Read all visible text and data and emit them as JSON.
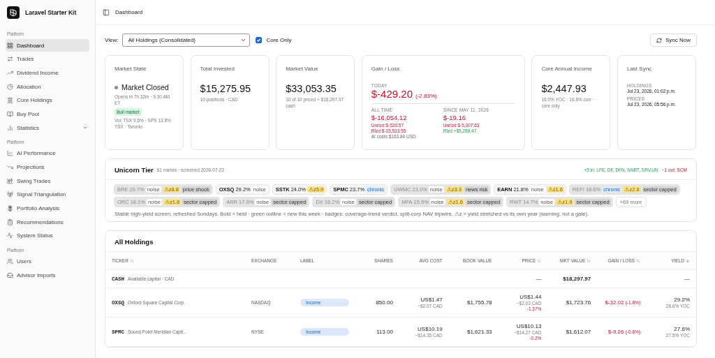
{
  "app": {
    "name": "Laravel Starter Kit"
  },
  "sidebar": {
    "sections": [
      {
        "label": "Platform",
        "items": [
          {
            "label": "Dashboard",
            "kind": "link",
            "selected": true
          },
          {
            "label": "Trades",
            "kind": "link",
            "selected": false
          },
          {
            "label": "Dividend Income",
            "kind": "link",
            "selected": false
          },
          {
            "label": "Allocation",
            "kind": "link",
            "selected": false
          },
          {
            "label": "Core Holdings",
            "kind": "link",
            "selected": false
          },
          {
            "label": "Buy Pool",
            "kind": "link",
            "selected": false
          },
          {
            "label": "Statistics",
            "kind": "group",
            "selected": false,
            "expanded": false
          }
        ]
      },
      {
        "label": "Platform",
        "items": [
          {
            "label": "AI Performance",
            "kind": "link",
            "selected": false
          },
          {
            "label": "Projections",
            "kind": "link",
            "selected": false
          },
          {
            "label": "Swing Trades",
            "kind": "link",
            "selected": false
          },
          {
            "label": "Signal Triangulation",
            "kind": "link",
            "selected": false
          },
          {
            "label": "Portfolio Analysis",
            "kind": "link",
            "selected": false
          },
          {
            "label": "Recommendations",
            "kind": "link",
            "selected": false
          },
          {
            "label": "System Status",
            "kind": "link",
            "selected": false
          }
        ]
      },
      {
        "label": "Platform",
        "items": [
          {
            "label": "Users",
            "kind": "link",
            "selected": false
          },
          {
            "label": "Advisor Imports",
            "kind": "link",
            "selected": false
          }
        ]
      }
    ]
  },
  "header": {
    "title": "Dashboard"
  },
  "controls": {
    "view_label": "View:",
    "view_value": "All Holdings (Consolidated)",
    "core_only": {
      "label": "Core Only",
      "checked": true
    },
    "sync_button": "Sync Now"
  },
  "market_state": {
    "title": "Market State",
    "status": "Market Closed",
    "opens": "Opens in 7h 32m · 9:30 AM ET",
    "regime": "Bull market",
    "vol": "Vol: TSX 9.6% · SPX 13.8%",
    "exchange": "TSX · Toronto"
  },
  "total_invested": {
    "title": "Total Invested",
    "value": "$15,275.95",
    "note": "10 positions · CAD"
  },
  "market_value": {
    "title": "Market Value",
    "value": "$33,053.35",
    "note": "10 of 10 priced + $18,297.97 cash"
  },
  "gain_loss": {
    "title": "Gain / Loss",
    "today_label": "TODAY",
    "today_value": "$-429.20",
    "today_pct": "(-2.83%)",
    "all_time": {
      "label": "ALL TIME",
      "value": "$-16,054.12",
      "lines": [
        {
          "text": "Unrlzd $-520.57",
          "kind": "loss"
        },
        {
          "text": "Rlzd $-15,533.55",
          "kind": "loss"
        },
        {
          "text": "AI costs $163.84 USD",
          "kind": "muted"
        }
      ]
    },
    "since": {
      "label": "SINCE MAY 11, 2026",
      "value": "$-19.16",
      "lines": [
        {
          "text": "Unrlzd $-5,307.63",
          "kind": "loss"
        },
        {
          "text": "Rlzd +$5,288.47",
          "kind": "gain"
        }
      ]
    }
  },
  "core_income": {
    "title": "Core Annual Income",
    "value": "$2,447.93",
    "note": "16.0% YOC · 16.6% curr · core only"
  },
  "last_sync": {
    "title": "Last Sync",
    "entries": [
      {
        "label": "HOLDINGS",
        "value": "Jul 23, 2026, 01:02 p.m."
      },
      {
        "label": "PRICES",
        "value": "Jul 23, 2026, 05:56 p.m."
      }
    ]
  },
  "unicorn": {
    "title": "Unicorn Tier",
    "meta": "81 names · screened 2026-07-23",
    "added": "+5 in: LFE, DF, DFN, NXRT, SRV.UN",
    "removed": "−1 out: SCM",
    "chips": [
      {
        "ticker": "BRE",
        "yield": "29.7%",
        "held": false,
        "badges": [
          {
            "text": "noise",
            "kind": "noise"
          },
          {
            "text": "⚠z8.8",
            "kind": "z"
          },
          {
            "text": "price shock",
            "kind": "tag"
          }
        ]
      },
      {
        "ticker": "OXSQ",
        "yield": "29.2%",
        "held": true,
        "badges": [
          {
            "text": "noise",
            "kind": "noise"
          }
        ]
      },
      {
        "ticker": "SSTK",
        "yield": "24.0%",
        "held": true,
        "badges": [
          {
            "text": "⚠z5.9",
            "kind": "z"
          }
        ]
      },
      {
        "ticker": "SPMC",
        "yield": "23.7%",
        "held": true,
        "badges": [
          {
            "text": "chronic",
            "kind": "chronic"
          }
        ]
      },
      {
        "ticker": "UWMC",
        "yield": "23.0%",
        "held": false,
        "badges": [
          {
            "text": "noise",
            "kind": "noise"
          },
          {
            "text": "⚠z3.3",
            "kind": "z"
          },
          {
            "text": "news risk",
            "kind": "tag"
          }
        ]
      },
      {
        "ticker": "EARN",
        "yield": "21.8%",
        "held": true,
        "badges": [
          {
            "text": "noise",
            "kind": "noise"
          },
          {
            "text": "⚠z1.6",
            "kind": "z"
          }
        ]
      },
      {
        "ticker": "REFI",
        "yield": "18.6%",
        "held": false,
        "badges": [
          {
            "text": "chronic",
            "kind": "chronic"
          },
          {
            "text": "⚠z2.8",
            "kind": "z"
          },
          {
            "text": "sector capped",
            "kind": "tag"
          }
        ]
      },
      {
        "ticker": "ORC",
        "yield": "18.1%",
        "held": false,
        "badges": [
          {
            "text": "noise",
            "kind": "noise"
          },
          {
            "text": "⚠z1.8",
            "kind": "z"
          },
          {
            "text": "sector capped",
            "kind": "tag"
          }
        ]
      },
      {
        "ticker": "ARR",
        "yield": "17.9%",
        "held": false,
        "badges": [
          {
            "text": "noise",
            "kind": "noise"
          },
          {
            "text": "sector capped",
            "kind": "tag"
          }
        ]
      },
      {
        "ticker": "DX",
        "yield": "16.2%",
        "held": false,
        "badges": [
          {
            "text": "noise",
            "kind": "noise"
          },
          {
            "text": "sector capped",
            "kind": "tag"
          }
        ]
      },
      {
        "ticker": "MFA",
        "yield": "15.9%",
        "held": false,
        "badges": [
          {
            "text": "noise",
            "kind": "noise"
          },
          {
            "text": "⚠z1.6",
            "kind": "z"
          },
          {
            "text": "sector capped",
            "kind": "tag"
          }
        ]
      },
      {
        "ticker": "RWT",
        "yield": "14.7%",
        "held": false,
        "badges": [
          {
            "text": "noise",
            "kind": "noise"
          },
          {
            "text": "⚠z1.9",
            "kind": "z"
          },
          {
            "text": "sector capped",
            "kind": "tag"
          }
        ]
      }
    ],
    "more": "+69 more",
    "footnote": "Stable high-yield screen, refreshed Sundays. Bold = held · green outline = new this week · badges: coverage-trend verdict, split-corp NAV tripwire. ⚠z = yield stretched vs its own year (warning, not a gate)."
  },
  "holdings": {
    "title": "All Holdings",
    "columns": [
      {
        "label": "TICKER",
        "kind": "sortable"
      },
      {
        "label": "EXCHANGE",
        "kind": "plain"
      },
      {
        "label": "LABEL",
        "kind": "plain"
      },
      {
        "label": "SHARES",
        "kind": "plain"
      },
      {
        "label": "AVG COST",
        "kind": "plain"
      },
      {
        "label": "BOOK VALUE",
        "kind": "plain"
      },
      {
        "label": "PRICE",
        "kind": "sortable"
      },
      {
        "label": "MKT VALUE",
        "kind": "sortable"
      },
      {
        "label": "GAIN / LOSS",
        "kind": "sortable"
      },
      {
        "label": "YIELD",
        "kind": "sorted"
      }
    ],
    "rows": [
      {
        "kind": "cash",
        "ticker": "CASH",
        "name": "Available capital · CAD",
        "price": "—",
        "mkt_value": "$18,297.97",
        "yield": "—"
      },
      {
        "kind": "position",
        "ticker": "OXSQ",
        "name": "Oxford Square Capital Corp.",
        "exchange": "NASDAQ",
        "label": "Income",
        "shares": "850.00",
        "avg_cost": "US$1.47",
        "avg_cost_cad": "~$2.07 CAD",
        "book_value": "$1,755.78",
        "price": "US$1.44",
        "price_cad": "~$2.03 CAD",
        "price_change": "-1.37%",
        "mkt_value": "$1,723.76",
        "gain": "$-32.02",
        "gain_pct": "(-1.8%)",
        "yield": "29.2%",
        "yoc": "28.6% YOC"
      },
      {
        "kind": "position",
        "ticker": "SPMC",
        "name": "Sound Point Meridian Capit...",
        "exchange": "NYSE",
        "label": "Income",
        "shares": "113.00",
        "avg_cost": "US$10.19",
        "avg_cost_cad": "~$14.35 CAD",
        "book_value": "$1,621.33",
        "price": "US$10.13",
        "price_cad": "~$14.27 CAD",
        "price_change": "-0.2%",
        "mkt_value": "$1,612.07",
        "gain": "$-9.26",
        "gain_pct": "(-0.6%)",
        "yield": "27.6%",
        "yoc": "27.5% YOC"
      }
    ]
  }
}
